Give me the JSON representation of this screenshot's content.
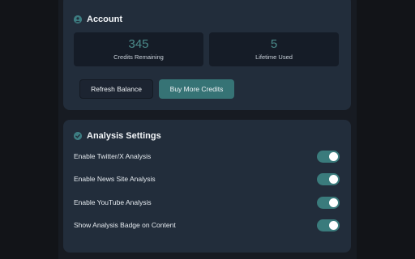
{
  "account": {
    "title": "Account",
    "credits_remaining_value": "345",
    "credits_remaining_label": "Credits Remaining",
    "lifetime_used_value": "5",
    "lifetime_used_label": "Lifetime Used",
    "refresh_label": "Refresh Balance",
    "buy_label": "Buy More Credits"
  },
  "settings": {
    "title": "Analysis Settings",
    "items": [
      {
        "label": "Enable Twitter/X Analysis",
        "enabled": true
      },
      {
        "label": "Enable News Site Analysis",
        "enabled": true
      },
      {
        "label": "Enable YouTube Analysis",
        "enabled": true
      },
      {
        "label": "Show Analysis Badge on Content",
        "enabled": true
      }
    ]
  },
  "colors": {
    "accent": "#3a7b7c",
    "card": "#222d3b",
    "background": "#121418"
  },
  "icons": {
    "account": "user-circle-icon",
    "settings": "check-circle-icon"
  }
}
